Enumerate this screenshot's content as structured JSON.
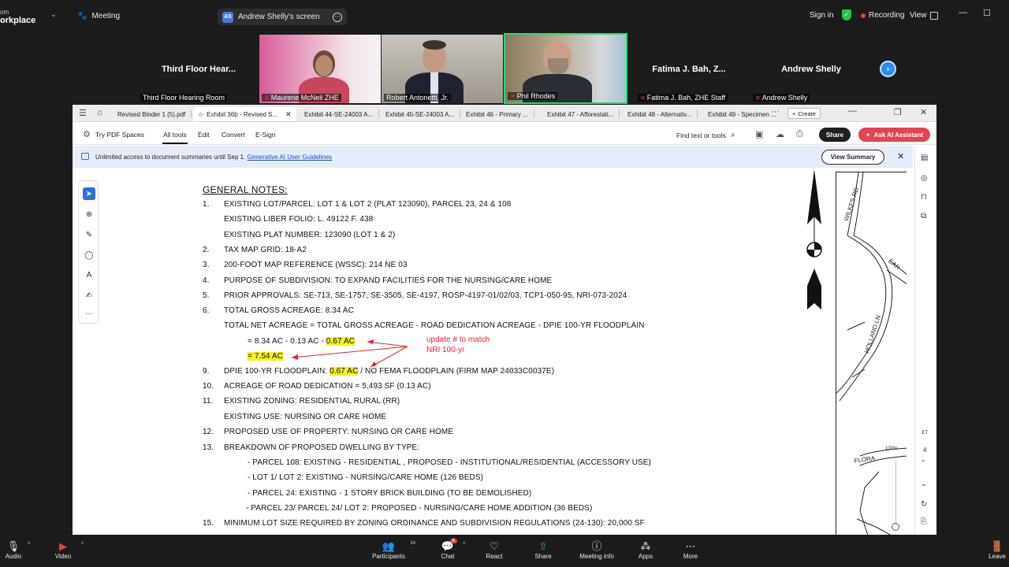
{
  "zoom": {
    "brand_top": "om",
    "brand": "orkplace",
    "meeting_label": "Meeting",
    "share_pill": {
      "initials": "AS",
      "label": "Andrew Shelly's screen"
    },
    "sign_in": "Sign in",
    "recording": "Recording",
    "view": "View",
    "participants": [
      {
        "name": "Third Floor Hear...",
        "label": "Third Floor Hearing Room",
        "video": false,
        "muted": false
      },
      {
        "name": "",
        "label": "Maurene McNeil ZHE",
        "video": true,
        "muted": true
      },
      {
        "name": "",
        "label": "Robert Antonetti, Jr.",
        "video": true,
        "muted": false
      },
      {
        "name": "",
        "label": "Phil Rhodes",
        "video": true,
        "muted": true
      },
      {
        "name": "Fatima J. Bah, Z...",
        "label": "Fatima J. Bah, ZHE Staff",
        "video": false,
        "muted": true
      },
      {
        "name": "Andrew Shelly",
        "label": "Andrew Shelly",
        "video": false,
        "muted": true
      }
    ],
    "bottom": {
      "audio": "Audio",
      "video": "Video",
      "participants": "Participants",
      "participants_count": "14",
      "chat": "Chat",
      "chat_badge": "6",
      "react": "React",
      "share": "Share",
      "meeting_info": "Meeting info",
      "apps": "Apps",
      "more": "More",
      "leave": "Leave"
    }
  },
  "acrobat": {
    "tabs": [
      "Revised Binder 1 (5).pdf",
      "Exhibit 36b - Revised S...",
      "Exhibit 44-SE-24003 A...",
      "Exhibit 45-SE-24003 A...",
      "Exhibit 46 - Primary ...",
      "Exhibit 47 - Afforestati...",
      "Exhibit 48 - Alternativ...",
      "Exhibit 49 - Specimen ..."
    ],
    "create": "Create",
    "toolbar": {
      "try_spaces": "Try PDF Spaces",
      "all_tools": "All tools",
      "edit": "Edit",
      "convert": "Convert",
      "esign": "E-Sign",
      "find": "Find text or tools",
      "share": "Share",
      "ai": "Ask AI Assistant"
    },
    "banner": {
      "text": "Unlimited access to document summaries until Sep 1.",
      "link": "Generative AI User Guidelines",
      "view_summary": "View Summary"
    },
    "zoom_pct": "100%",
    "page_num": "4"
  },
  "document": {
    "heading": "GENERAL NOTES:",
    "lines": [
      {
        "num": "1.",
        "text": "EXISTING LOT/PARCEL: LOT 1 & LOT 2 (PLAT 123090), PARCEL 23, 24 & 108"
      },
      {
        "num": "",
        "text": "EXISTING LIBER FOLIO: L. 49122 F. 438"
      },
      {
        "num": "",
        "text": "EXISTING PLAT NUMBER: 123090 (LOT 1 & 2)"
      },
      {
        "num": "2.",
        "text": "TAX MAP GRID: 18-A2"
      },
      {
        "num": "3.",
        "text": "200-FOOT MAP REFERENCE (WSSC): 214 NE 03"
      },
      {
        "num": "4.",
        "text": "PURPOSE OF SUBDIVISION: TO EXPAND FACILITIES FOR THE NURSING/CARE HOME"
      },
      {
        "num": "5.",
        "text": "PRIOR APPROVALS: SE-713, SE-1757, SE-3505, SE-4197, ROSP-4197-01/02/03, TCP1-050-95, NRI-073-2024"
      },
      {
        "num": "6.",
        "text": "TOTAL GROSS ACREAGE: 8.34 AC"
      },
      {
        "num": "",
        "text": "TOTAL NET ACREAGE = TOTAL GROSS ACREAGE  - ROAD DEDICATION ACREAGE - DPIE 100-YR FLOODPLAIN"
      }
    ],
    "calc1_prefix": "= 8.34 AC - 0.13 AC - ",
    "calc1_hl": "0.67 AC",
    "calc2_hl": "= 7.54 AC",
    "item9_num": "9.",
    "item9_prefix": "DPIE 100-YR FLOODPLAIN: ",
    "item9_hl": "0.67 AC",
    "item9_suffix": " /  NO FEMA FLOODPLAIN (FIRM MAP 24033C0037E)",
    "lines2": [
      {
        "num": "10.",
        "text": "ACREAGE OF ROAD DEDICATION = 5,493 SF (0.13 AC)"
      },
      {
        "num": "11.",
        "text": "EXISTING ZONING: RESIDENTIAL RURAL (RR)"
      },
      {
        "num": "",
        "text": "EXISTING USE: NURSING OR CARE HOME"
      },
      {
        "num": "12.",
        "text": "PROPOSED USE OF PROPERTY: NURSING OR CARE HOME"
      },
      {
        "num": "13.",
        "text": "BREAKDOWN OF PROPOSED DWELLING BY TYPE:"
      }
    ],
    "sub_items": [
      "-  PARCEL 108: EXISTING - RESIDENTIAL , PROPOSED - INSTITUTIONAL/RESIDENTIAL (ACCESSORY USE)",
      "-  LOT 1/ LOT 2: EXISTING - NURSING/CARE HOME (126 BEDS)",
      "-  PARCEL 24: EXISTING - 1 STORY BRICK BUILDING (TO BE DEMOLISHED)",
      "- PARCEL 23/ PARCEL 24/ LOT 2: PROPOSED - NURSING/CARE HOME ADDITION (36 BEDS)"
    ],
    "item15_num": "15.",
    "item15_text": "MINIMUM LOT SIZE REQUIRED BY ZONING ORDINANCE AND SUBDIVISION REGULATIONS (24-130): 20,000 SF",
    "annotation_line1": "update # to match",
    "annotation_line2": "NRI 100-yr",
    "map_labels": {
      "wilkes": "WILKES RD",
      "holland": "HOLLAND LN",
      "ear": "EAR",
      "flora": "FLORA",
      "corner": "N"
    }
  }
}
